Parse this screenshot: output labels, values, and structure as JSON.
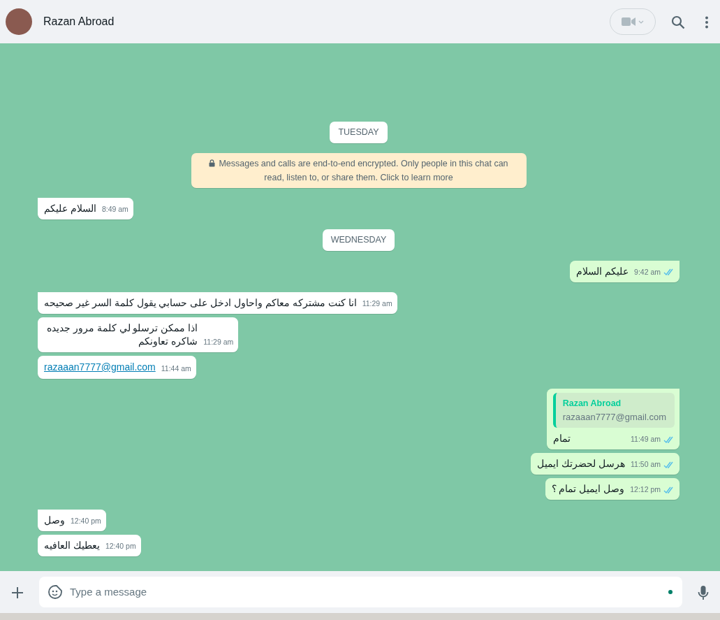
{
  "header": {
    "contact_name": "Razan Abroad"
  },
  "timeline": [
    {
      "kind": "date",
      "text": "TUESDAY"
    },
    {
      "kind": "system",
      "text": "Messages and calls are end-to-end encrypted. Only people in this chat can read, listen to, or share them. Click to learn more"
    },
    {
      "kind": "message",
      "outgoing": false,
      "first": true,
      "text": "السلام عليكم",
      "time": "8:49 am",
      "link": false
    },
    {
      "kind": "date",
      "text": "WEDNESDAY"
    },
    {
      "kind": "message",
      "outgoing": true,
      "first": true,
      "text": "عليكم السلام",
      "time": "9:42 am",
      "read": true,
      "link": false
    },
    {
      "kind": "message",
      "outgoing": false,
      "first": true,
      "text": "انا كنت مشتركه معاكم واحاول ادخل على حسابي يقول كلمة السر غير صحيحه",
      "time": "11:29 am",
      "link": false
    },
    {
      "kind": "message",
      "outgoing": false,
      "first": false,
      "text": "اذا ممكن ترسلو لي كلمة مرور جديده \nشاكره تعاونكم",
      "time": "11:29 am",
      "link": false
    },
    {
      "kind": "message",
      "outgoing": false,
      "first": false,
      "text": "razaaan7777@gmail.com",
      "time": "11:44 am",
      "link": true
    },
    {
      "kind": "message",
      "outgoing": true,
      "first": true,
      "quote": {
        "author": "Razan Abroad",
        "text": "razaaan7777@gmail.com"
      },
      "text": "تمام",
      "time": "11:49 am",
      "read": true,
      "link": false
    },
    {
      "kind": "message",
      "outgoing": true,
      "first": false,
      "text": "هرسل لحضرتك ايميل",
      "time": "11:50 am",
      "read": true,
      "link": false
    },
    {
      "kind": "message",
      "outgoing": true,
      "first": false,
      "text": "وصل ايميل تمام ؟",
      "time": "12:12 pm",
      "read": true,
      "link": false
    },
    {
      "kind": "message",
      "outgoing": false,
      "first": true,
      "text": "وصل",
      "time": "12:40 pm",
      "link": false
    },
    {
      "kind": "message",
      "outgoing": false,
      "first": false,
      "text": "يعطيك العافيه",
      "time": "12:40 pm",
      "link": false
    }
  ],
  "composer": {
    "placeholder": "Type a message"
  }
}
